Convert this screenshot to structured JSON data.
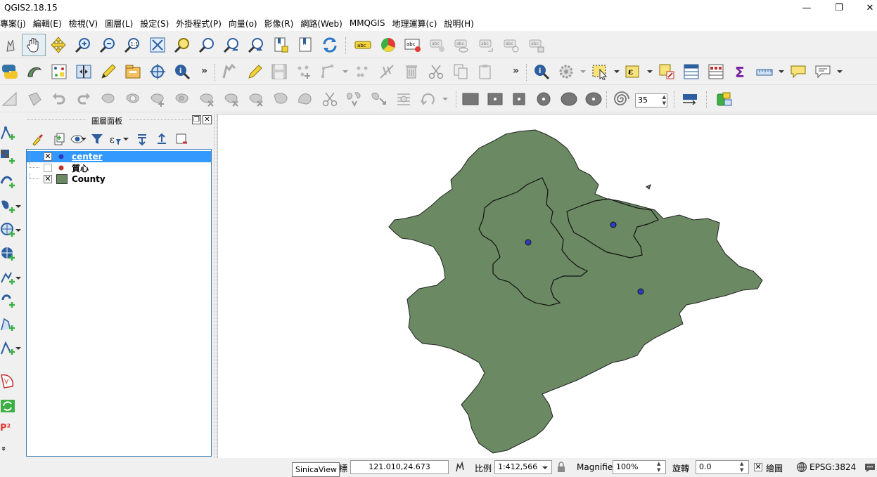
{
  "window": {
    "title": "QGIS2.18.15",
    "minimize": "—",
    "restore": "❐",
    "close": "✕"
  },
  "menu": [
    "專案(j)",
    "編輯(E)",
    "檢視(V)",
    "圖層(L)",
    "設定(S)",
    "外掛程式(P)",
    "向量(o)",
    "影像(R)",
    "網路(Web)",
    "MMQGIS",
    "地理運算(c)",
    "說明(H)"
  ],
  "toolbar": {
    "more1": "»",
    "more2": "»",
    "more3": "»",
    "rotation_spin": "35"
  },
  "left_toolbar": {
    "p2_label": "P²",
    "more": "»"
  },
  "layers_panel": {
    "title": "圖層面板",
    "float": "❐",
    "close": "✕",
    "layers": [
      {
        "name": "center",
        "checked": true,
        "symbol_color": "#2a3fbf",
        "selected": true
      },
      {
        "name": "質心",
        "checked": false,
        "symbol_color": "#c0312b",
        "selected": false
      },
      {
        "name": "County",
        "checked": true,
        "symbol_color": "#6b8a63",
        "selected": false
      }
    ]
  },
  "map": {
    "fill_color": "#6b8a63",
    "point_color": "#2a3fbf"
  },
  "status": {
    "coord_label": "標",
    "coordinate": "121.010,24.673",
    "scale_label": "比例",
    "scale": "1:412,566",
    "magnifier_label": "Magnifier",
    "magnifier": "100%",
    "rotation_label": "旋轉",
    "rotation": "0.0",
    "render_label": "繪圖",
    "crs": "EPSG:3824"
  },
  "tooltip": "SinicaView"
}
